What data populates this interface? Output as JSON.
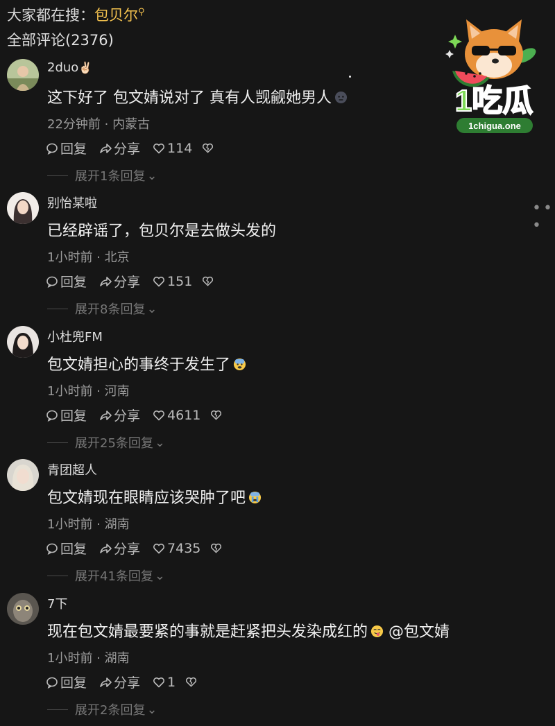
{
  "header": {
    "hot_search_prefix": "大家都在搜：",
    "hot_search_keyword": "包贝尔",
    "total_comments": "全部评论(2376)"
  },
  "logo": {
    "text": "1吃瓜",
    "url": "1chigua.one"
  },
  "labels": {
    "reply": "回复",
    "share": "分享"
  },
  "comments": [
    {
      "username": "2duo",
      "username_emoji": "✌🏻",
      "text": "这下好了 包文婧说对了 真有人觊觎她男人",
      "emoji": "dark-face",
      "time_location": "22分钟前 · 内蒙古",
      "likes": "114",
      "expand": "展开1条回复"
    },
    {
      "username": "别怡某啦",
      "username_emoji": "",
      "text": "已经辟谣了，包贝尔是去做头发的",
      "emoji": "",
      "time_location": "1小时前 · 北京",
      "likes": "151",
      "expand": "展开8条回复"
    },
    {
      "username": "小杜兜FM",
      "username_emoji": "",
      "text": "包文婧担心的事终于发生了",
      "emoji": "anxious-face",
      "time_location": "1小时前 · 河南",
      "likes": "4611",
      "expand": "展开25条回复"
    },
    {
      "username": "青团超人",
      "username_emoji": "",
      "text": "包文婧现在眼睛应该哭肿了吧",
      "emoji": "crying-face",
      "time_location": "1小时前 · 湖南",
      "likes": "7435",
      "expand": "展开41条回复"
    },
    {
      "username": "7下",
      "username_emoji": "",
      "text": "现在包文婧最要紧的事就是赶紧把头发染成红的",
      "emoji": "tongue-face",
      "mention": "@包文婧",
      "time_location": "1小时前 · 湖南",
      "likes": "1",
      "expand": "展开2条回复"
    }
  ],
  "colors": {
    "background": "#161616",
    "keyword": "#f2c14e",
    "logo_green": "#7ed957"
  }
}
